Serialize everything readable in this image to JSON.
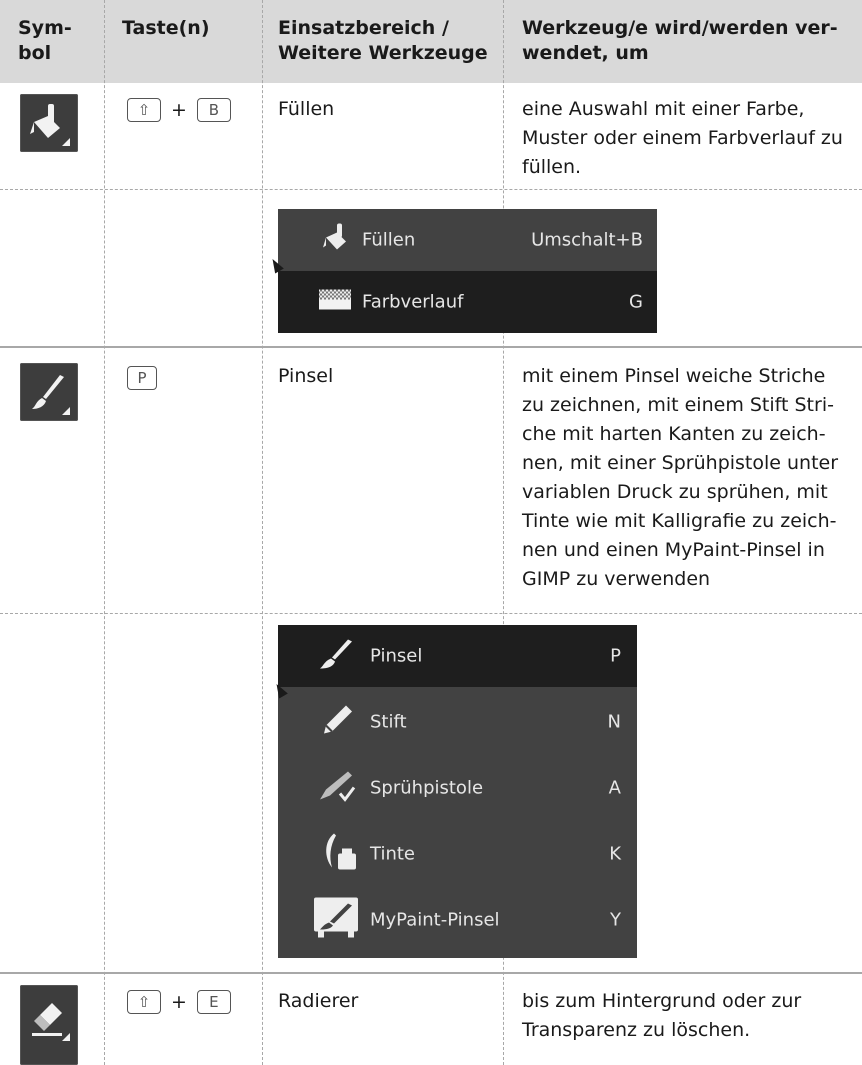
{
  "header": {
    "col1": "Sym-\nbol",
    "col2": "Taste(n)",
    "col3": "Einsatzbereich /\nWeitere Werkzeuge",
    "col4": "Werkzeug/e wird/werden ver-\nwendet, um"
  },
  "rows": [
    {
      "icon": "bucket-fill-icon",
      "keys": [
        "⇧",
        "B"
      ],
      "plus": "+",
      "area": "Füllen",
      "description": "eine Auswahl mit einer Farbe,\nMuster oder einem Farbverlauf zu\nfüllen."
    },
    {
      "icon": "paintbrush-icon",
      "keys": [
        "P"
      ],
      "area": "Pinsel",
      "description": "mit einem Pinsel weiche Striche\nzu zeichnen, mit einem Stift Stri-\nche mit harten Kanten zu zeich-\nnen, mit einer Sprühpistole unter\nvariablen Druck zu sprühen, mit\nTinte wie mit Kalligrafie zu zeich-\nnen und einen MyPaint-Pinsel in\nGIMP zu verwenden"
    },
    {
      "icon": "eraser-icon",
      "keys": [
        "⇧",
        "E"
      ],
      "plus": "+",
      "area": "Radierer",
      "description": "bis zum Hintergrund oder zur\nTransparenz zu löschen."
    }
  ],
  "fill_menu": [
    {
      "label": "Füllen",
      "shortcut": "Umschalt+B",
      "icon": "bucket-fill-icon",
      "active": false
    },
    {
      "label": "Farbverlauf",
      "shortcut": "G",
      "icon": "gradient-icon",
      "active": true
    }
  ],
  "brush_menu": [
    {
      "label": "Pinsel",
      "shortcut": "P",
      "icon": "paintbrush-icon",
      "active": true
    },
    {
      "label": "Stift",
      "shortcut": "N",
      "icon": "pencil-icon",
      "active": false
    },
    {
      "label": "Sprühpistole",
      "shortcut": "A",
      "icon": "airbrush-icon",
      "active": false
    },
    {
      "label": "Tinte",
      "shortcut": "K",
      "icon": "ink-icon",
      "active": false
    },
    {
      "label": "MyPaint-Pinsel",
      "shortcut": "Y",
      "icon": "mypaint-brush-icon",
      "active": false
    }
  ],
  "colors": {
    "header_bg": "#d9d9d9",
    "icon_bg": "#3d3d3d",
    "menu_bg": "#424242",
    "menu_active_bg": "#1e1e1e"
  }
}
